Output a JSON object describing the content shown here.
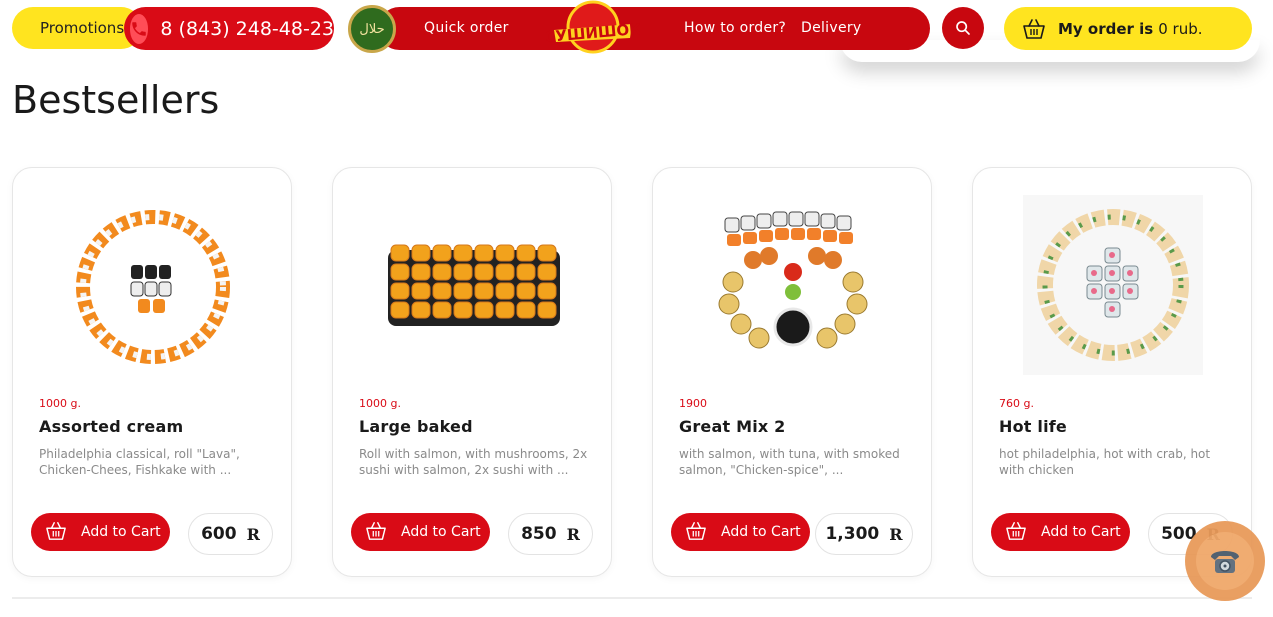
{
  "header": {
    "promotions_label": "Promotions",
    "phone": "8 (843) 248-48-23",
    "halal_text": "حلال",
    "nav": {
      "quick_order": "Quick order",
      "how_to_order": "How to order?",
      "delivery": "Delivery"
    },
    "logo_text": "СУШИШОК",
    "order": {
      "label": "My order is",
      "value": "0 rub."
    }
  },
  "page_title": "Bestsellers",
  "currency_symbol": "R",
  "add_to_cart_label": "Add to Cart",
  "products": [
    {
      "weight": "1000 g.",
      "name": "Assorted cream",
      "description": "Philadelphia classical, roll \"Lava\", Chicken-Chees, Fishkake with ...",
      "price": "600"
    },
    {
      "weight": "1000 g.",
      "name": "Large baked",
      "description": "Roll with salmon, with mushrooms, 2x sushi with salmon, 2x sushi with ...",
      "price": "850"
    },
    {
      "weight": "1900",
      "name": "Great Mix 2",
      "description": "with salmon, with tuna, with smoked salmon, \"Chicken-spice\", ...",
      "price": "1,300"
    },
    {
      "weight": "760 g.",
      "name": "Hot life",
      "description": "hot philadelphia, hot with crab, hot with chicken",
      "price": "500"
    }
  ],
  "colors": {
    "brand_red": "#d90b16",
    "brand_yellow": "#ffe41f",
    "halal_green": "#2f6b1e",
    "call_widget": "#e89a5a"
  },
  "icons": [
    "phone-icon",
    "halal-badge-icon",
    "search-icon",
    "basket-icon",
    "call-phone-icon"
  ]
}
